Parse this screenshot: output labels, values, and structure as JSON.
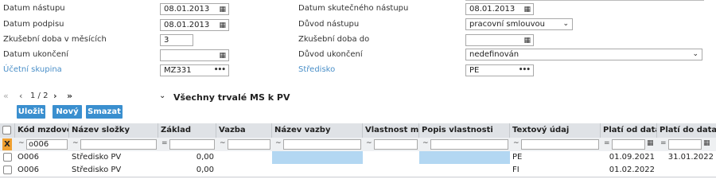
{
  "form": {
    "datum_nastupu": {
      "label": "Datum nástupu",
      "value": "08.01.2013"
    },
    "datum_podpisu": {
      "label": "Datum podpisu",
      "value": "08.01.2013"
    },
    "zkusebni_doba": {
      "label": "Zkušební doba v měsících",
      "value": "3"
    },
    "datum_ukonceni": {
      "label": "Datum ukončení",
      "value": ""
    },
    "ucetni_skupina": {
      "label": "Účetní skupina",
      "value": "MZ331"
    },
    "datum_skutecneho_nastupu": {
      "label": "Datum skutečného nástupu",
      "value": "08.01.2013"
    },
    "duvod_nastupu": {
      "label": "Důvod nástupu",
      "value": "pracovní smlouvou"
    },
    "zkusebni_doba_do": {
      "label": "Zkušební doba do",
      "value": ""
    },
    "duvod_ukonceni": {
      "label": "Důvod ukončení",
      "value": "nedefinován"
    },
    "stredisko": {
      "label": "Středisko",
      "value": "PE"
    }
  },
  "pager": {
    "text": "1 / 2"
  },
  "toolbar": {
    "ulozit": "Uložit",
    "novy": "Nový",
    "smazat": "Smazat"
  },
  "grid": {
    "title": "Všechny trvalé MS k PV",
    "columns": [
      "Kód mzdové složky",
      "Název složky",
      "Základ",
      "Vazba",
      "Název vazby",
      "Vlastnost mzdové složky",
      "Popis vlastnosti",
      "Textový údaj",
      "Platí od data",
      "Platí do data"
    ],
    "filter": {
      "x": "X",
      "kod_value": "o006",
      "ops": [
        "~",
        "~",
        "=",
        "~",
        "~",
        "~",
        "~",
        "~",
        "=",
        "="
      ]
    },
    "rows": [
      {
        "kod": "O006",
        "nazev": "Středisko PV",
        "zaklad": "0,00",
        "vazba": "",
        "nazev_vazby": "",
        "vlastnost": "",
        "popis": "",
        "text": "PE",
        "od": "01.09.2021",
        "do": "31.01.2022"
      },
      {
        "kod": "O006",
        "nazev": "Středisko PV",
        "zaklad": "0,00",
        "vazba": "",
        "nazev_vazby": "",
        "vlastnost": "",
        "popis": "",
        "text": "FI",
        "od": "01.02.2022",
        "do": ""
      }
    ]
  },
  "colors": {
    "accent": "#3a8fcf",
    "row_highlight": "#b3d7f2",
    "filter_x": "#f0a030",
    "link_label": "#4a8fc8"
  }
}
